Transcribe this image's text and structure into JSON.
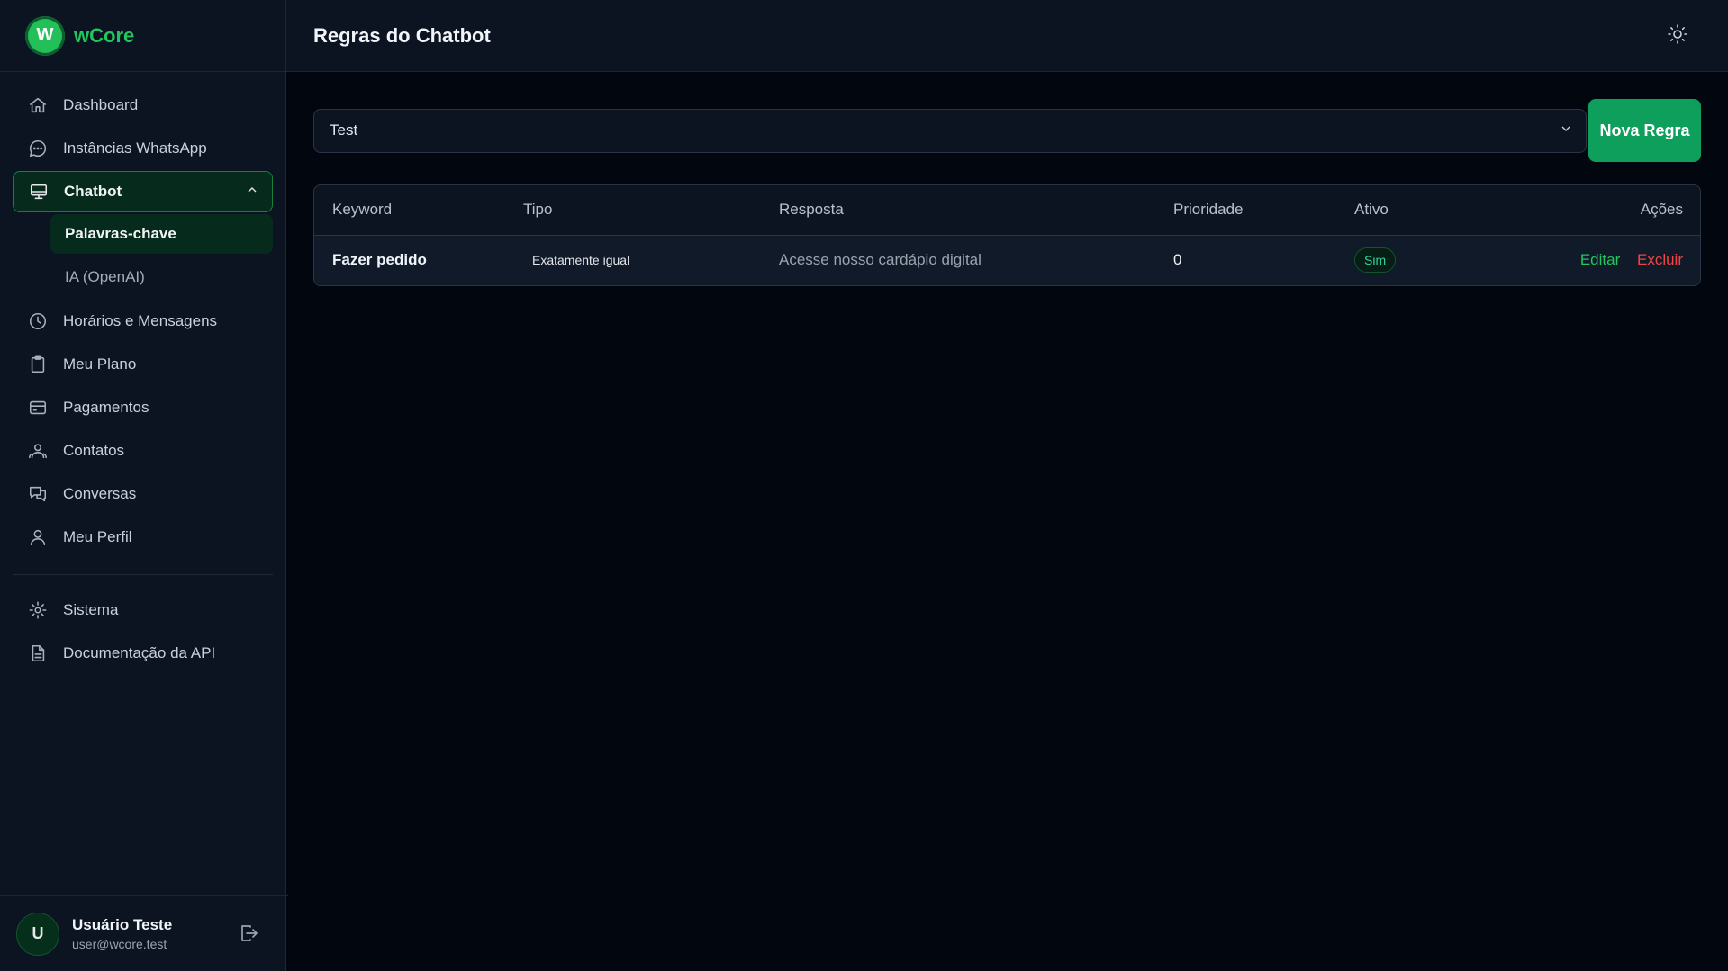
{
  "brand": {
    "logo_letter": "W",
    "name": "wCore"
  },
  "sidebar": {
    "items": [
      {
        "label": "Dashboard",
        "icon": "home-icon"
      },
      {
        "label": "Instâncias WhatsApp",
        "icon": "chat-bubble-icon"
      },
      {
        "label": "Chatbot",
        "icon": "monitor-icon",
        "expanded": true,
        "children": [
          {
            "label": "Palavras-chave",
            "active": true
          },
          {
            "label": "IA (OpenAI)"
          }
        ]
      },
      {
        "label": "Horários e Mensagens",
        "icon": "clock-icon"
      },
      {
        "label": "Meu Plano",
        "icon": "clipboard-icon"
      },
      {
        "label": "Pagamentos",
        "icon": "credit-card-icon"
      },
      {
        "label": "Contatos",
        "icon": "users-icon"
      },
      {
        "label": "Conversas",
        "icon": "chats-icon"
      },
      {
        "label": "Meu Perfil",
        "icon": "user-icon"
      }
    ],
    "secondary": [
      {
        "label": "Sistema",
        "icon": "gear-icon"
      },
      {
        "label": "Documentação da API",
        "icon": "document-icon"
      }
    ]
  },
  "user": {
    "initial": "U",
    "name": "Usuário Teste",
    "email": "user@wcore.test"
  },
  "header": {
    "title": "Regras do Chatbot"
  },
  "filter": {
    "selected": "Test"
  },
  "actions": {
    "new_rule": "Nova Regra"
  },
  "table": {
    "columns": [
      "Keyword",
      "Tipo",
      "Resposta",
      "Prioridade",
      "Ativo",
      "Ações"
    ],
    "rows": [
      {
        "keyword": "Fazer pedido",
        "tipo": "Exatamente igual",
        "resposta": "Acesse nosso cardápio digital",
        "prioridade": "0",
        "ativo": "Sim",
        "edit": "Editar",
        "delete": "Excluir"
      }
    ]
  },
  "colors": {
    "accent": "#22c55e",
    "danger": "#ef4444",
    "background": "#02060f",
    "panel": "#0c1422"
  }
}
